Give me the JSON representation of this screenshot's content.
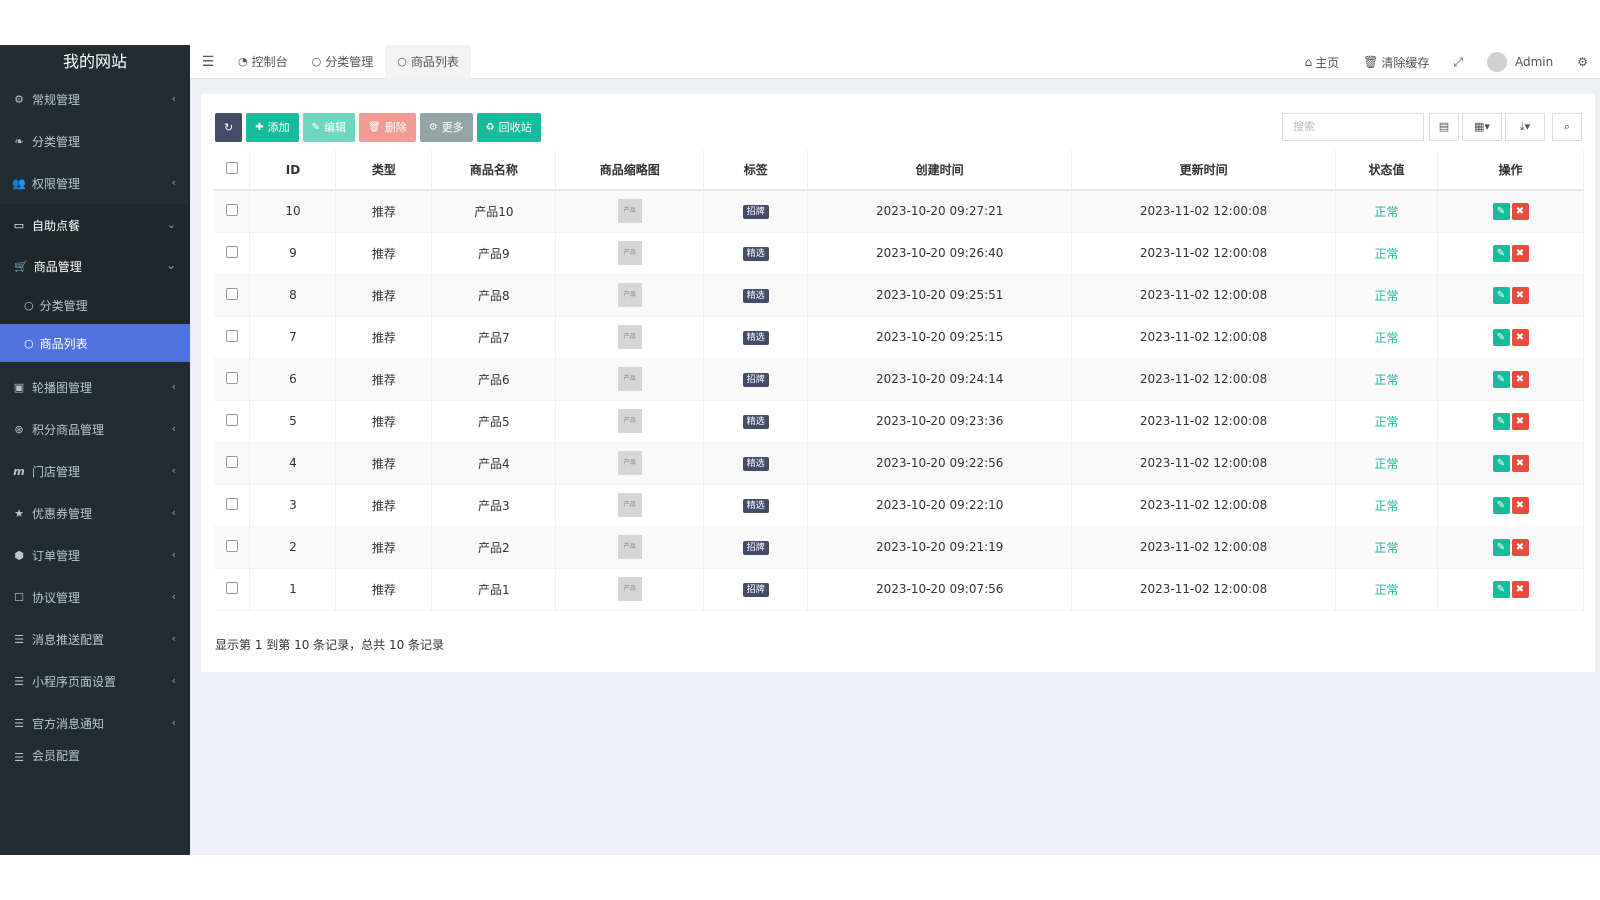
{
  "sidebar": {
    "logo": "我的网站",
    "items": [
      {
        "label": "常规管理",
        "icon": "cogs-icon"
      },
      {
        "label": "分类管理",
        "icon": "leaf-icon"
      },
      {
        "label": "权限管理",
        "icon": "users-icon"
      },
      {
        "label": "自助点餐",
        "icon": "laptop-icon"
      },
      {
        "label": "商品管理",
        "icon": "cart-icon"
      },
      {
        "label": "分类管理",
        "icon": "circle-icon"
      },
      {
        "label": "商品列表",
        "icon": "circle-icon"
      },
      {
        "label": "轮播图管理",
        "icon": "image-icon"
      },
      {
        "label": "积分商品管理",
        "icon": "gift-icon"
      },
      {
        "label": "门店管理",
        "icon": "store-icon"
      },
      {
        "label": "优惠券管理",
        "icon": "star-icon"
      },
      {
        "label": "订单管理",
        "icon": "order-icon"
      },
      {
        "label": "协议管理",
        "icon": "square-icon"
      },
      {
        "label": "消息推送配置",
        "icon": "list-icon"
      },
      {
        "label": "小程序页面设置",
        "icon": "list-icon"
      },
      {
        "label": "官方消息通知",
        "icon": "list-icon"
      },
      {
        "label": "会员配置",
        "icon": "list-icon"
      }
    ]
  },
  "header": {
    "tabs": [
      {
        "label": "控制台"
      },
      {
        "label": "分类管理"
      },
      {
        "label": "商品列表"
      }
    ],
    "home": "主页",
    "clear_cache": "清除缓存",
    "user": "Admin"
  },
  "toolbar": {
    "add": "添加",
    "edit": "编辑",
    "delete": "删除",
    "more": "更多",
    "recycle": "回收站",
    "search_placeholder": "搜索"
  },
  "table": {
    "headers": [
      "ID",
      "类型",
      "商品名称",
      "商品缩略图",
      "标签",
      "创建时间",
      "更新时间",
      "状态值",
      "操作"
    ],
    "rows": [
      {
        "id": "10",
        "type": "推荐",
        "name": "产品10",
        "thumb": "产品",
        "tag": "招牌",
        "created": "2023-10-20 09:27:21",
        "updated": "2023-11-02 12:00:08",
        "status": "正常"
      },
      {
        "id": "9",
        "type": "推荐",
        "name": "产品9",
        "thumb": "产品",
        "tag": "精选",
        "created": "2023-10-20 09:26:40",
        "updated": "2023-11-02 12:00:08",
        "status": "正常"
      },
      {
        "id": "8",
        "type": "推荐",
        "name": "产品8",
        "thumb": "产品",
        "tag": "精选",
        "created": "2023-10-20 09:25:51",
        "updated": "2023-11-02 12:00:08",
        "status": "正常"
      },
      {
        "id": "7",
        "type": "推荐",
        "name": "产品7",
        "thumb": "产品",
        "tag": "精选",
        "created": "2023-10-20 09:25:15",
        "updated": "2023-11-02 12:00:08",
        "status": "正常"
      },
      {
        "id": "6",
        "type": "推荐",
        "name": "产品6",
        "thumb": "产品",
        "tag": "招牌",
        "created": "2023-10-20 09:24:14",
        "updated": "2023-11-02 12:00:08",
        "status": "正常"
      },
      {
        "id": "5",
        "type": "推荐",
        "name": "产品5",
        "thumb": "产品",
        "tag": "精选",
        "created": "2023-10-20 09:23:36",
        "updated": "2023-11-02 12:00:08",
        "status": "正常"
      },
      {
        "id": "4",
        "type": "推荐",
        "name": "产品4",
        "thumb": "产品",
        "tag": "精选",
        "created": "2023-10-20 09:22:56",
        "updated": "2023-11-02 12:00:08",
        "status": "正常"
      },
      {
        "id": "3",
        "type": "推荐",
        "name": "产品3",
        "thumb": "产品",
        "tag": "精选",
        "created": "2023-10-20 09:22:10",
        "updated": "2023-11-02 12:00:08",
        "status": "正常"
      },
      {
        "id": "2",
        "type": "推荐",
        "name": "产品2",
        "thumb": "产品",
        "tag": "招牌",
        "created": "2023-10-20 09:21:19",
        "updated": "2023-11-02 12:00:08",
        "status": "正常"
      },
      {
        "id": "1",
        "type": "推荐",
        "name": "产品1",
        "thumb": "产品",
        "tag": "招牌",
        "created": "2023-10-20 09:07:56",
        "updated": "2023-11-02 12:00:08",
        "status": "正常"
      }
    ]
  },
  "pager": {
    "summary": "显示第 1 到第 10 条记录，总共 10 条记录"
  },
  "colors": {
    "sidebar_bg": "#222d32",
    "active_blue": "#4e73df",
    "success_green": "#18bc9c",
    "danger_red": "#e74c3c",
    "tag_dark": "#444c69"
  }
}
